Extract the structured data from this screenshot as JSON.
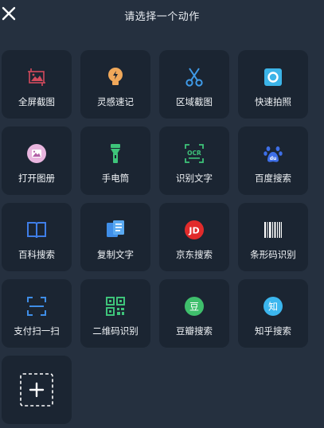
{
  "header": {
    "title": "请选择一个动作"
  },
  "actions": [
    {
      "label": "全屏截图",
      "icon": "fullscreen-screenshot-icon"
    },
    {
      "label": "灵感速记",
      "icon": "lightbulb-icon"
    },
    {
      "label": "区域截图",
      "icon": "scissors-icon"
    },
    {
      "label": "快速拍照",
      "icon": "camera-icon"
    },
    {
      "label": "打开图册",
      "icon": "gallery-icon"
    },
    {
      "label": "手电筒",
      "icon": "flashlight-icon"
    },
    {
      "label": "识别文字",
      "icon": "ocr-icon"
    },
    {
      "label": "百度搜索",
      "icon": "baidu-paw-icon"
    },
    {
      "label": "百科搜索",
      "icon": "book-icon"
    },
    {
      "label": "复制文字",
      "icon": "copy-document-icon"
    },
    {
      "label": "京东搜索",
      "icon": "jd-icon"
    },
    {
      "label": "条形码识别",
      "icon": "barcode-icon"
    },
    {
      "label": "支付扫一扫",
      "icon": "scan-icon"
    },
    {
      "label": "二维码识别",
      "icon": "qrcode-icon"
    },
    {
      "label": "豆瓣搜索",
      "icon": "douban-icon"
    },
    {
      "label": "知乎搜索",
      "icon": "zhihu-icon"
    }
  ],
  "add_tile": {
    "icon": "add-icon"
  },
  "icon_text": {
    "ocr": "OCR",
    "baidu": "du",
    "jd": "JD",
    "douban": "豆",
    "zhihu": "知"
  }
}
